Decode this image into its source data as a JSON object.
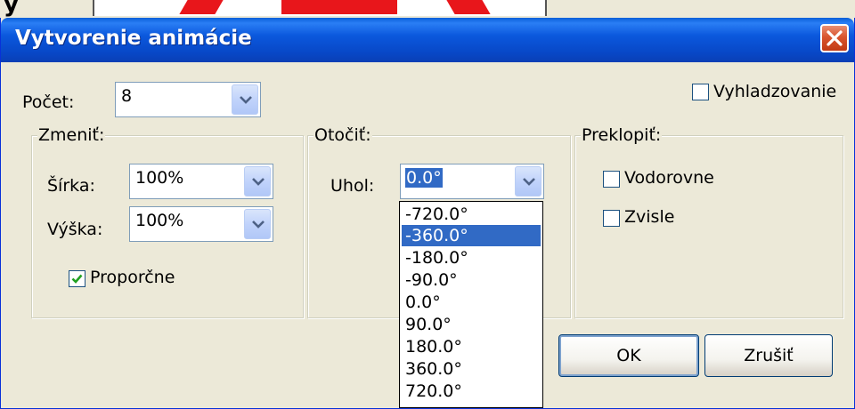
{
  "dialog": {
    "title": "Vytvorenie animácie",
    "count_label": "Počet:",
    "count_value": "8",
    "smoothing_label": "Vyhladzovanie",
    "smoothing_checked": false
  },
  "change_group": {
    "title": "Zmeniť:",
    "width_label": "Šírka:",
    "width_value": "100%",
    "height_label": "Výška:",
    "height_value": "100%",
    "proportional_label": "Proporčne",
    "proportional_checked": true
  },
  "rotate_group": {
    "title": "Otočiť:",
    "angle_label": "Uhol:",
    "angle_value": "0.0°",
    "options": [
      "-720.0°",
      "-360.0°",
      "-180.0°",
      "-90.0°",
      "0.0°",
      "90.0°",
      "180.0°",
      "360.0°",
      "720.0°"
    ],
    "highlighted_option": "-360.0°"
  },
  "flip_group": {
    "title": "Preklopiť:",
    "horizontal_label": "Vodorovne",
    "horizontal_checked": false,
    "vertical_label": "Zvisle",
    "vertical_checked": false
  },
  "buttons": {
    "ok_label": "OK",
    "cancel_label": "Zrušiť"
  },
  "background": {
    "letter": "y",
    "shape_color": "#e8161b"
  },
  "colors": {
    "title_bar": "#0a56d9",
    "selection": "#316ac5",
    "close_button": "#d9542e"
  }
}
